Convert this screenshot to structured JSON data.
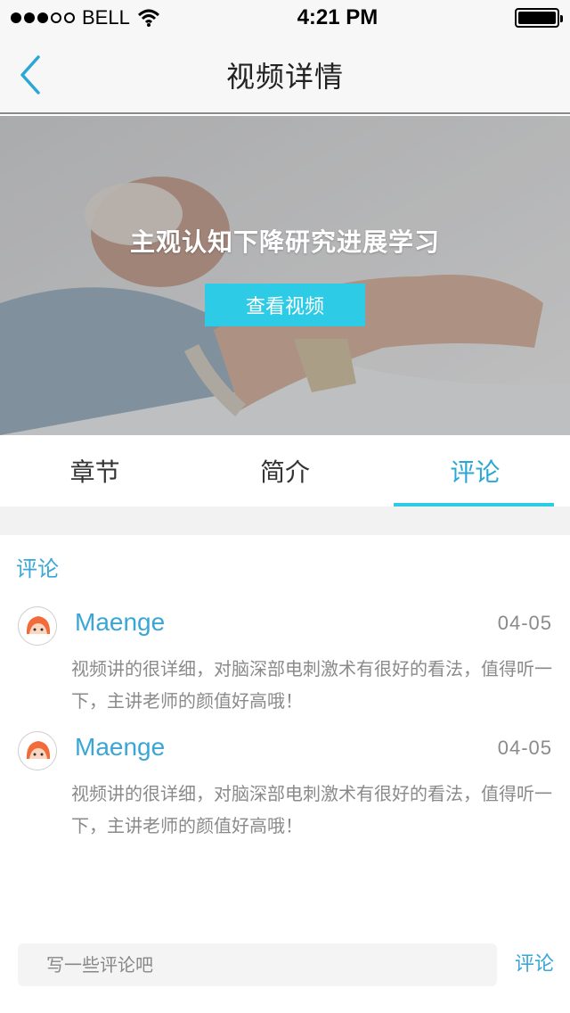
{
  "status_bar": {
    "carrier": "BELL",
    "time": "4:21 PM",
    "signal_icon": "signal-dots-icon",
    "wifi_icon": "wifi-icon",
    "battery_icon": "battery-icon"
  },
  "nav": {
    "title": "视频详情",
    "back_icon": "chevron-left-icon"
  },
  "hero": {
    "title": "主观认知下降研究进展学习",
    "button_label": "查看视频"
  },
  "tabs": [
    {
      "label": "章节",
      "active": false
    },
    {
      "label": "简介",
      "active": false
    },
    {
      "label": "评论",
      "active": true
    }
  ],
  "comments_section": {
    "title": "评论",
    "items": [
      {
        "name": "Maenge",
        "date": "04-05",
        "text": "视频讲的很详细，对脑深部电刺激术有很好的看法，值得听一下，主讲老师的颜值好高哦！"
      },
      {
        "name": "Maenge",
        "date": "04-05",
        "text": "视频讲的很详细，对脑深部电刺激术有很好的看法，值得听一下，主讲老师的颜值好高哦！"
      }
    ]
  },
  "input": {
    "placeholder": "写一些评论吧",
    "submit_label": "评论"
  },
  "colors": {
    "accent": "#2ecbe6",
    "link": "#3aa6d6",
    "muted": "#8a8a8a"
  }
}
